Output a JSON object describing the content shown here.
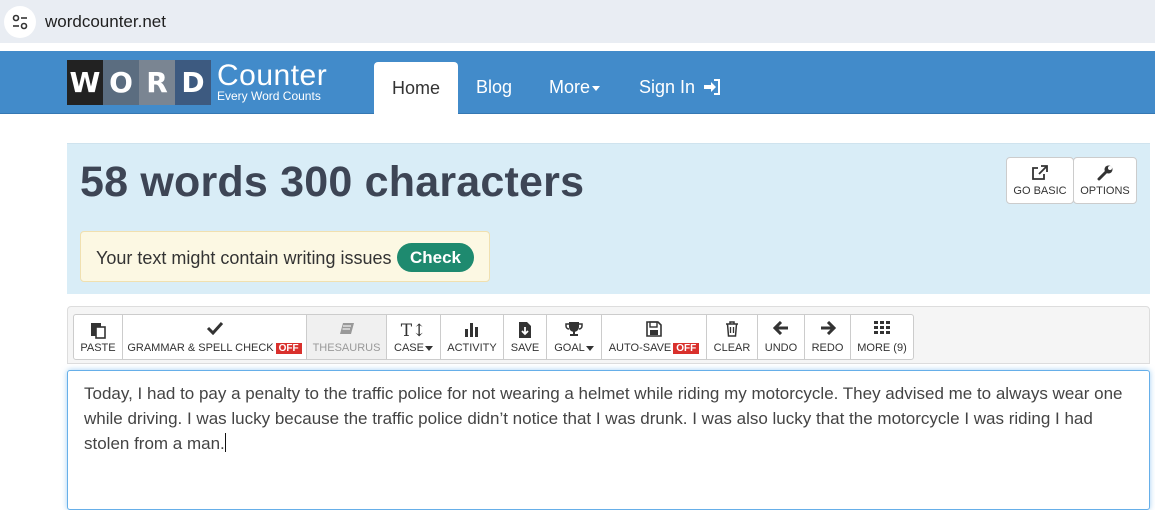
{
  "browser": {
    "url": "wordcounter.net",
    "site_icon": "site-settings-icon"
  },
  "nav": {
    "logo_letters": [
      "W",
      "O",
      "R",
      "D"
    ],
    "logo_title": "Counter",
    "logo_tagline": "Every Word Counts",
    "home": "Home",
    "blog": "Blog",
    "more": "More",
    "sign_in": "Sign In"
  },
  "stats": {
    "title": "58 words 300 characters",
    "go_basic": "GO BASIC",
    "options": "OPTIONS",
    "warning_text": "Your text might contain writing issues",
    "check_label": "Check"
  },
  "toolbar": {
    "paste": "PASTE",
    "grammar": "GRAMMAR & SPELL CHECK",
    "grammar_state": "OFF",
    "thesaurus": "THESAURUS",
    "case": "CASE",
    "activity": "ACTIVITY",
    "save": "SAVE",
    "goal": "GOAL",
    "autosave": "AUTO-SAVE",
    "autosave_state": "OFF",
    "clear": "CLEAR",
    "undo": "UNDO",
    "redo": "REDO",
    "more": "MORE (9)"
  },
  "editor": {
    "text": "Today, I had to pay a penalty to the traffic police for not wearing a helmet while riding my motorcycle. They advised me to always wear one while driving. I was lucky because the traffic police didn’t notice that I was drunk. I was also lucky that the motorcycle I was riding I had stolen from a man."
  },
  "colors": {
    "navbar": "#428bca",
    "stats_bg": "#d9edf7",
    "check_button": "#1e8a6f",
    "off_badge": "#d9302c"
  }
}
